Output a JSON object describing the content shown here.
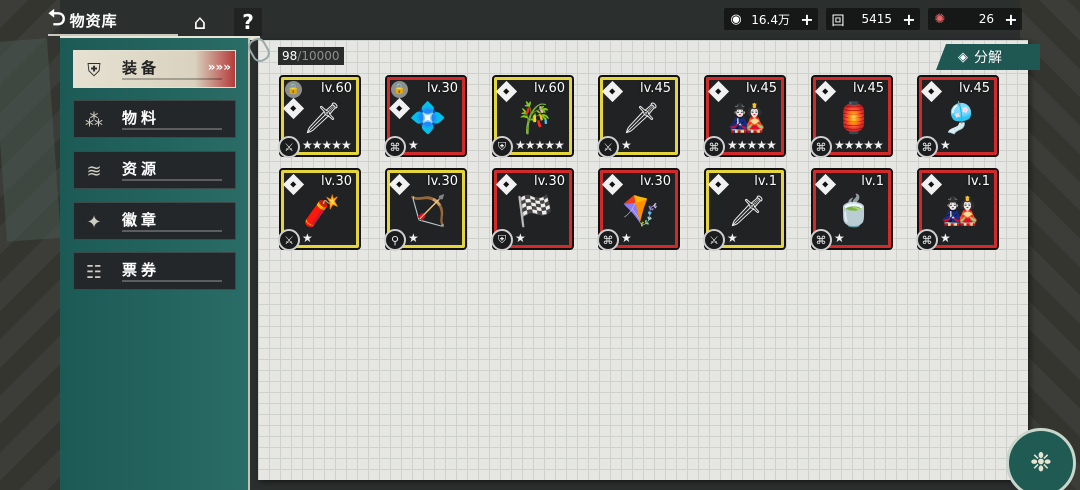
{
  "header": {
    "back_glyph": "⮌",
    "title": "物资库",
    "home_glyph": "⌂",
    "help_glyph": "?"
  },
  "currencies": [
    {
      "icon": "◉",
      "value": "16.4万",
      "plus": "+"
    },
    {
      "icon": "回",
      "value": "5415",
      "plus": "+"
    },
    {
      "icon": "✺",
      "value": "26",
      "plus": "+"
    }
  ],
  "sidebar": {
    "items": [
      {
        "label": "装备",
        "icon": "⛨",
        "active": true,
        "arrows": "»»»"
      },
      {
        "label": "物料",
        "icon": "⁂",
        "active": false
      },
      {
        "label": "资源",
        "icon": "≋",
        "active": false
      },
      {
        "label": "徽章",
        "icon": "✦",
        "active": false
      },
      {
        "label": "票券",
        "icon": "☷",
        "active": false
      }
    ]
  },
  "capacity": {
    "current": "98",
    "max": "/10000"
  },
  "dismantle": {
    "label": "分解",
    "icon": "◈"
  },
  "items": [
    {
      "lv": "lv.60",
      "art": "🗡",
      "border": "yellow",
      "stars": "★★★★★",
      "type": "⚔",
      "lock": true
    },
    {
      "lv": "lv.30",
      "art": "💠",
      "border": "red",
      "stars": "★",
      "type": "⌘",
      "lock": true
    },
    {
      "lv": "lv.60",
      "art": "🎋",
      "border": "yellow",
      "stars": "★★★★★",
      "type": "⛨",
      "lock": false
    },
    {
      "lv": "lv.45",
      "art": "🗡",
      "border": "yellow",
      "stars": "★",
      "type": "⚔",
      "lock": false
    },
    {
      "lv": "lv.45",
      "art": "🎎",
      "border": "red",
      "stars": "★★★★★",
      "type": "⌘",
      "lock": false
    },
    {
      "lv": "lv.45",
      "art": "🏮",
      "border": "red",
      "stars": "★★★★★",
      "type": "⌘",
      "lock": false
    },
    {
      "lv": "lv.45",
      "art": "🎐",
      "border": "red",
      "stars": "★",
      "type": "⌘",
      "lock": false
    },
    {
      "lv": "lv.30",
      "art": "🧨",
      "border": "yellow",
      "stars": "★",
      "type": "⚔",
      "lock": false
    },
    {
      "lv": "lv.30",
      "art": "🏹",
      "border": "yellow",
      "stars": "★",
      "type": "⚲",
      "lock": false
    },
    {
      "lv": "lv.30",
      "art": "🏁",
      "border": "red",
      "stars": "★",
      "type": "⛨",
      "lock": false
    },
    {
      "lv": "lv.30",
      "art": "🪁",
      "border": "red",
      "stars": "★",
      "type": "⌘",
      "lock": false
    },
    {
      "lv": "lv.1",
      "art": "🗡",
      "border": "yellow",
      "stars": "★",
      "type": "⚔",
      "lock": false
    },
    {
      "lv": "lv.1",
      "art": "🍵",
      "border": "red",
      "stars": "★",
      "type": "⌘",
      "lock": false
    },
    {
      "lv": "lv.1",
      "art": "🎎",
      "border": "red",
      "stars": "★",
      "type": "⌘",
      "lock": false
    }
  ],
  "colors": {
    "rare_border": "#d12a2a",
    "epic_border": "#e5d43a",
    "sidebar_teal": "#1c5a56"
  }
}
